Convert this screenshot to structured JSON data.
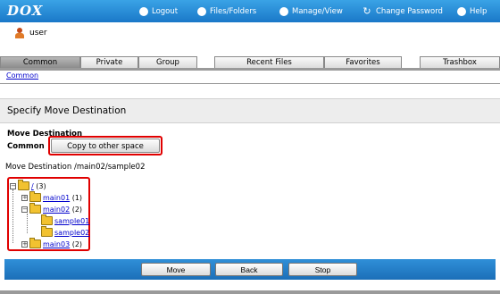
{
  "header": {
    "logo": "DOX",
    "nav": [
      {
        "label": "Logout",
        "icon": "logout-icon"
      },
      {
        "label": "Files/Folders",
        "icon": "files-folders-icon"
      },
      {
        "label": "Manage/View",
        "icon": "manage-view-icon"
      },
      {
        "label": "Change Password",
        "icon": "change-password-icon"
      },
      {
        "label": "Help",
        "icon": "help-icon"
      }
    ]
  },
  "user": {
    "name": "user"
  },
  "tabs": {
    "common": "Common",
    "private": "Private",
    "group": "Group",
    "recent": "Recent Files",
    "favorites": "Favorites",
    "trashbox": "Trashbox"
  },
  "breadcrumb": "Common",
  "section": {
    "title": "Specify Move Destination"
  },
  "destination": {
    "heading": "Move Destination",
    "space_label": "Common",
    "copy_button": "Copy to other space",
    "path_text": "Move Destination /main02/sample02"
  },
  "tree": {
    "root": {
      "label": "/",
      "count": "(3)"
    },
    "main01": {
      "label": "main01",
      "count": "(1)"
    },
    "main02": {
      "label": "main02",
      "count": "(2)"
    },
    "sample01": {
      "label": "sample01"
    },
    "sample02": {
      "label": "sample02"
    },
    "main03": {
      "label": "main03",
      "count": "(2)"
    }
  },
  "buttons": {
    "move": "Move",
    "back": "Back",
    "stop": "Stop"
  },
  "colors": {
    "header_blue": "#1a78c8",
    "highlight_red": "#e00000",
    "link_blue": "#0000cc"
  }
}
